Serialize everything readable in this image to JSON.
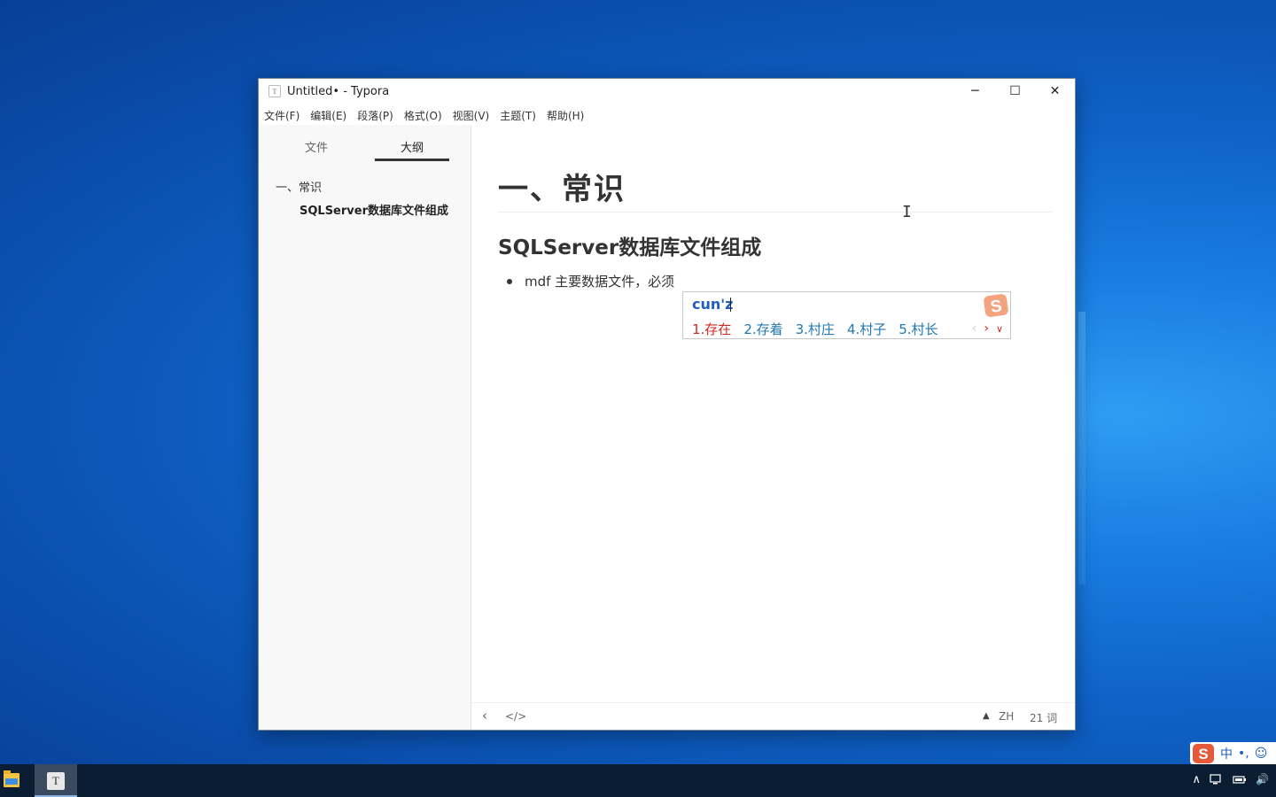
{
  "window": {
    "title": "Untitled• - Typora",
    "minimize": "─",
    "maximize": "☐",
    "close": "✕"
  },
  "menu": [
    "文件(F)",
    "编辑(E)",
    "段落(P)",
    "格式(O)",
    "视图(V)",
    "主题(T)",
    "帮助(H)"
  ],
  "sidebar": {
    "tabs": [
      "文件",
      "大纲"
    ],
    "active_tab": "大纲",
    "outline": [
      {
        "label": "一、常识",
        "level": 1
      },
      {
        "label": "SQLServer数据库文件组成",
        "level": 2
      }
    ]
  },
  "editor": {
    "h1": "一、常识",
    "h2": "SQLServer数据库文件组成",
    "bullet": "mdf 主要数据文件，必须"
  },
  "ime": {
    "input": "cun'z",
    "candidates": [
      "1.存在",
      "2.存着",
      "3.村庄",
      "4.村子",
      "5.村长"
    ],
    "accent": "#d02a1e",
    "candidate_color": "#1f77b4"
  },
  "statusbar": {
    "back": "‹",
    "source": "</>",
    "warning": "▲",
    "lang": "ZH",
    "word_count": "21 词"
  },
  "ime_bar": {
    "mode": "中",
    "punct": "•,",
    "emoji": "☺"
  },
  "taskbar": {
    "typora_icon_letter": "T",
    "tray_up": "∧",
    "volume": "🔊"
  }
}
